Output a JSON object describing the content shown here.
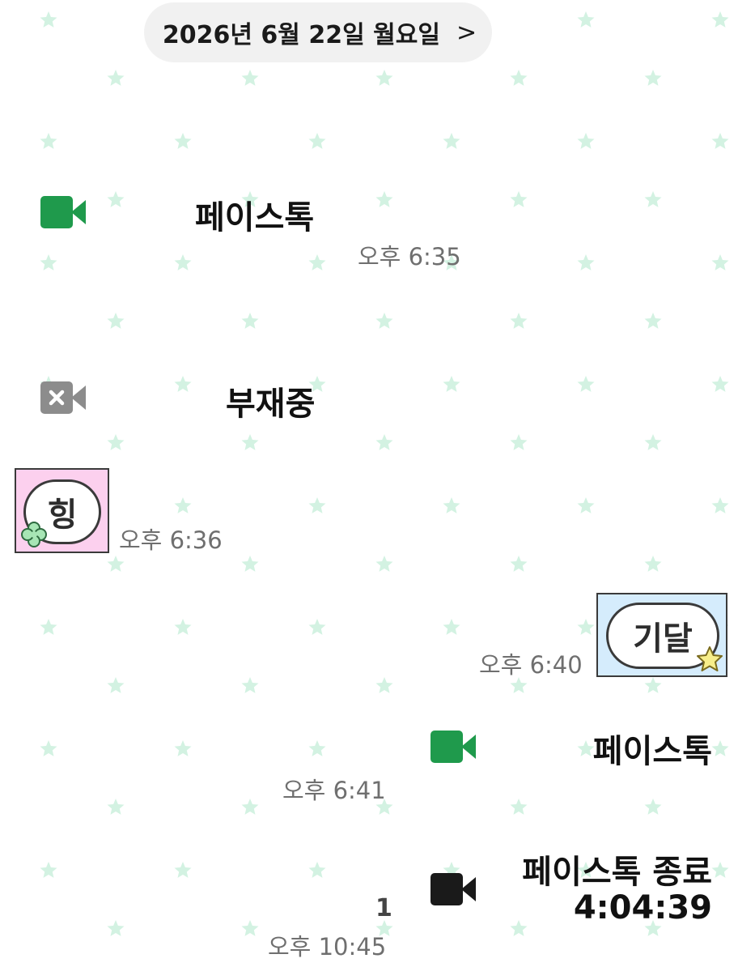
{
  "date_header": {
    "text": "2026년 6월 22일 월요일",
    "chevron": ">"
  },
  "messages": [
    {
      "type": "call",
      "side": "left",
      "label": "페이스톡",
      "time": "오후 6:35",
      "icon": "video-camera-icon"
    },
    {
      "type": "call",
      "side": "left",
      "label": "부재중",
      "time": "",
      "icon": "missed-video-call-icon"
    },
    {
      "type": "sticker",
      "side": "left",
      "text": "힝",
      "time": "오후 6:36",
      "icon": "clover-icon"
    },
    {
      "type": "sticker",
      "side": "right",
      "text": "기달",
      "time": "오후 6:40",
      "icon": "star-icon"
    },
    {
      "type": "call",
      "side": "right",
      "label": "페이스톡",
      "time": "오후 6:41",
      "icon": "video-camera-icon"
    },
    {
      "type": "call",
      "side": "right",
      "label": "페이스톡 종료",
      "duration": "4:04:39",
      "unread": "1",
      "time": "오후 10:45",
      "icon": "video-camera-icon"
    }
  ],
  "colors": {
    "background": "#ffffff",
    "star": "#d3f2e2",
    "call_green": "#1f9a4c",
    "missed_gray": "#8c8c8c",
    "ended_black": "#1a1a1a",
    "sticker1_bg": "#fcd0ee",
    "sticker2_bg": "#d5ecfc"
  }
}
